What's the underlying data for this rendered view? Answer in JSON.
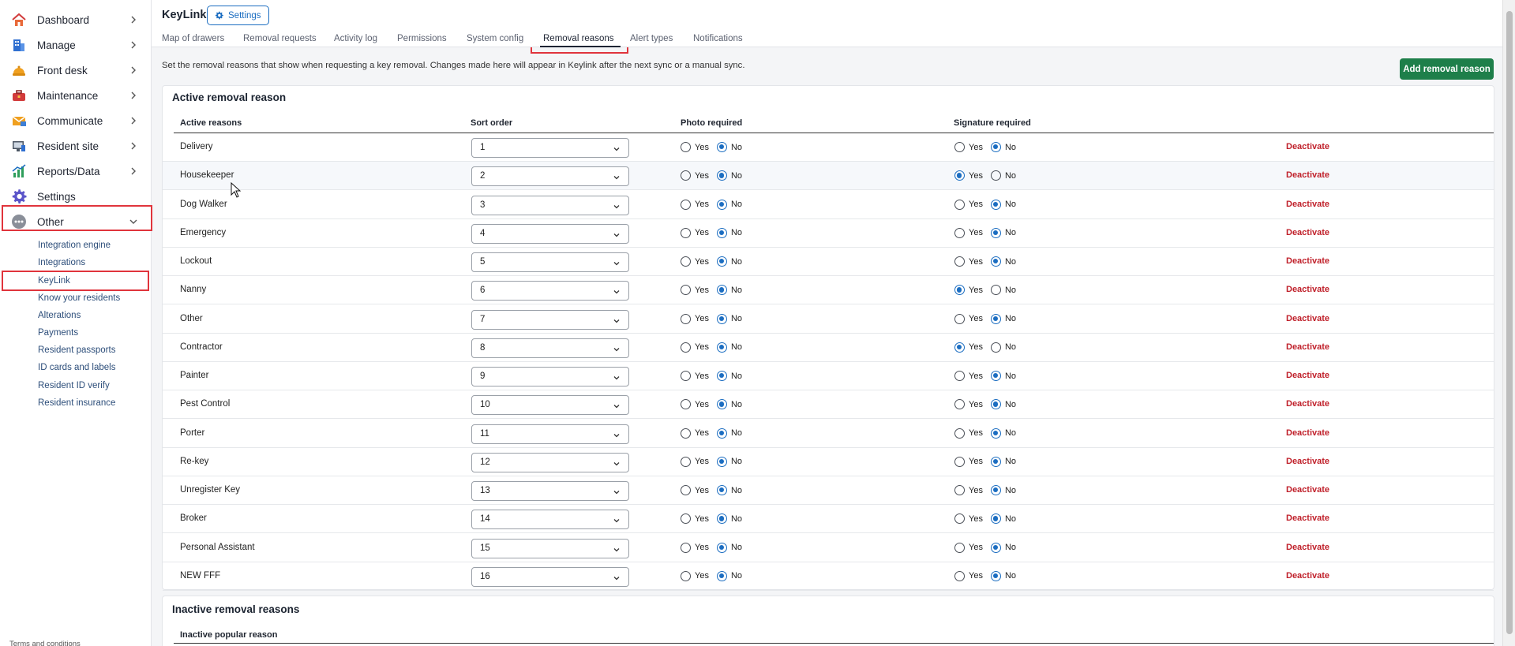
{
  "sidebar": {
    "items": [
      {
        "label": "Dashboard",
        "icon": "dashboard-house-icon",
        "has_chevron": true
      },
      {
        "label": "Manage",
        "icon": "building-icon",
        "has_chevron": true
      },
      {
        "label": "Front desk",
        "icon": "service-bell-icon",
        "has_chevron": true
      },
      {
        "label": "Maintenance",
        "icon": "toolbox-icon",
        "has_chevron": true
      },
      {
        "label": "Communicate",
        "icon": "envelope-icon",
        "has_chevron": true
      },
      {
        "label": "Resident site",
        "icon": "monitor-icon",
        "has_chevron": true
      },
      {
        "label": "Reports/Data",
        "icon": "bar-chart-icon",
        "has_chevron": true
      },
      {
        "label": "Settings",
        "icon": "gear-icon",
        "has_chevron": false
      },
      {
        "label": "Other",
        "icon": "more-dots-icon",
        "has_chevron": true,
        "expanded": true
      }
    ],
    "sub_items": [
      "Integration engine",
      "Integrations",
      "KeyLink",
      "Know your residents",
      "Alterations",
      "Payments",
      "Resident passports",
      "ID cards and labels",
      "Resident ID verify",
      "Resident insurance"
    ],
    "footer": "Terms and conditions"
  },
  "header": {
    "title": "KeyLink",
    "settings_label": "Settings",
    "tabs": [
      "Map of drawers",
      "Removal requests",
      "Activity log",
      "Permissions",
      "System config",
      "Removal reasons",
      "Alert types",
      "Notifications"
    ],
    "active_tab": "Removal reasons"
  },
  "main": {
    "description": "Set the removal reasons that show when requesting a key removal. Changes made here will appear in Keylink after the next sync or a manual sync.",
    "add_button": "Add removal reason",
    "active_section_title": "Active removal reason",
    "columns": [
      "Active reasons",
      "Sort order",
      "Photo required",
      "Signature required"
    ],
    "yes_label": "Yes",
    "no_label": "No",
    "deactivate_label": "Deactivate",
    "rows": [
      {
        "name": "Delivery",
        "sort": "1",
        "photo": "No",
        "signature": "No"
      },
      {
        "name": "Housekeeper",
        "sort": "2",
        "photo": "No",
        "signature": "Yes"
      },
      {
        "name": "Dog Walker",
        "sort": "3",
        "photo": "No",
        "signature": "No"
      },
      {
        "name": "Emergency",
        "sort": "4",
        "photo": "No",
        "signature": "No"
      },
      {
        "name": "Lockout",
        "sort": "5",
        "photo": "No",
        "signature": "No"
      },
      {
        "name": "Nanny",
        "sort": "6",
        "photo": "No",
        "signature": "Yes"
      },
      {
        "name": "Other",
        "sort": "7",
        "photo": "No",
        "signature": "No"
      },
      {
        "name": "Contractor",
        "sort": "8",
        "photo": "No",
        "signature": "Yes"
      },
      {
        "name": "Painter",
        "sort": "9",
        "photo": "No",
        "signature": "No"
      },
      {
        "name": "Pest Control",
        "sort": "10",
        "photo": "No",
        "signature": "No"
      },
      {
        "name": "Porter",
        "sort": "11",
        "photo": "No",
        "signature": "No"
      },
      {
        "name": "Re-key",
        "sort": "12",
        "photo": "No",
        "signature": "No"
      },
      {
        "name": "Unregister Key",
        "sort": "13",
        "photo": "No",
        "signature": "No"
      },
      {
        "name": "Broker",
        "sort": "14",
        "photo": "No",
        "signature": "No"
      },
      {
        "name": "Personal Assistant",
        "sort": "15",
        "photo": "No",
        "signature": "No"
      },
      {
        "name": "NEW FFF",
        "sort": "16",
        "photo": "No",
        "signature": "No"
      }
    ],
    "inactive_section_title": "Inactive removal reasons",
    "inactive_column": "Inactive popular reason"
  },
  "colors": {
    "accent_blue": "#1b6dc1",
    "add_button_green": "#1e7f4a",
    "deactivate_red": "#c0212b",
    "highlight_red": "#e0343c"
  }
}
